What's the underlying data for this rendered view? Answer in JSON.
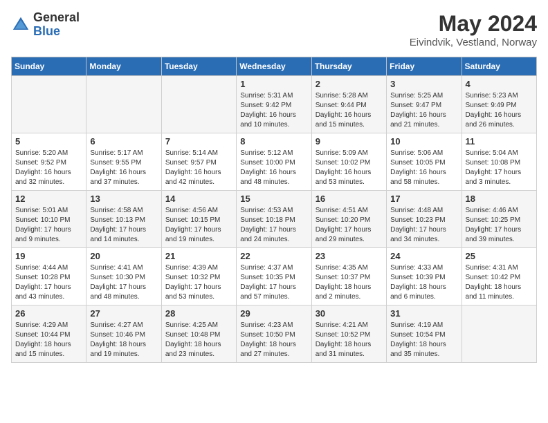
{
  "header": {
    "logo_general": "General",
    "logo_blue": "Blue",
    "month_title": "May 2024",
    "location": "Eivindvik, Vestland, Norway"
  },
  "days_of_week": [
    "Sunday",
    "Monday",
    "Tuesday",
    "Wednesday",
    "Thursday",
    "Friday",
    "Saturday"
  ],
  "weeks": [
    [
      {
        "day": "",
        "info": ""
      },
      {
        "day": "",
        "info": ""
      },
      {
        "day": "",
        "info": ""
      },
      {
        "day": "1",
        "info": "Sunrise: 5:31 AM\nSunset: 9:42 PM\nDaylight: 16 hours and 10 minutes."
      },
      {
        "day": "2",
        "info": "Sunrise: 5:28 AM\nSunset: 9:44 PM\nDaylight: 16 hours and 15 minutes."
      },
      {
        "day": "3",
        "info": "Sunrise: 5:25 AM\nSunset: 9:47 PM\nDaylight: 16 hours and 21 minutes."
      },
      {
        "day": "4",
        "info": "Sunrise: 5:23 AM\nSunset: 9:49 PM\nDaylight: 16 hours and 26 minutes."
      }
    ],
    [
      {
        "day": "5",
        "info": "Sunrise: 5:20 AM\nSunset: 9:52 PM\nDaylight: 16 hours and 32 minutes."
      },
      {
        "day": "6",
        "info": "Sunrise: 5:17 AM\nSunset: 9:55 PM\nDaylight: 16 hours and 37 minutes."
      },
      {
        "day": "7",
        "info": "Sunrise: 5:14 AM\nSunset: 9:57 PM\nDaylight: 16 hours and 42 minutes."
      },
      {
        "day": "8",
        "info": "Sunrise: 5:12 AM\nSunset: 10:00 PM\nDaylight: 16 hours and 48 minutes."
      },
      {
        "day": "9",
        "info": "Sunrise: 5:09 AM\nSunset: 10:02 PM\nDaylight: 16 hours and 53 minutes."
      },
      {
        "day": "10",
        "info": "Sunrise: 5:06 AM\nSunset: 10:05 PM\nDaylight: 16 hours and 58 minutes."
      },
      {
        "day": "11",
        "info": "Sunrise: 5:04 AM\nSunset: 10:08 PM\nDaylight: 17 hours and 3 minutes."
      }
    ],
    [
      {
        "day": "12",
        "info": "Sunrise: 5:01 AM\nSunset: 10:10 PM\nDaylight: 17 hours and 9 minutes."
      },
      {
        "day": "13",
        "info": "Sunrise: 4:58 AM\nSunset: 10:13 PM\nDaylight: 17 hours and 14 minutes."
      },
      {
        "day": "14",
        "info": "Sunrise: 4:56 AM\nSunset: 10:15 PM\nDaylight: 17 hours and 19 minutes."
      },
      {
        "day": "15",
        "info": "Sunrise: 4:53 AM\nSunset: 10:18 PM\nDaylight: 17 hours and 24 minutes."
      },
      {
        "day": "16",
        "info": "Sunrise: 4:51 AM\nSunset: 10:20 PM\nDaylight: 17 hours and 29 minutes."
      },
      {
        "day": "17",
        "info": "Sunrise: 4:48 AM\nSunset: 10:23 PM\nDaylight: 17 hours and 34 minutes."
      },
      {
        "day": "18",
        "info": "Sunrise: 4:46 AM\nSunset: 10:25 PM\nDaylight: 17 hours and 39 minutes."
      }
    ],
    [
      {
        "day": "19",
        "info": "Sunrise: 4:44 AM\nSunset: 10:28 PM\nDaylight: 17 hours and 43 minutes."
      },
      {
        "day": "20",
        "info": "Sunrise: 4:41 AM\nSunset: 10:30 PM\nDaylight: 17 hours and 48 minutes."
      },
      {
        "day": "21",
        "info": "Sunrise: 4:39 AM\nSunset: 10:32 PM\nDaylight: 17 hours and 53 minutes."
      },
      {
        "day": "22",
        "info": "Sunrise: 4:37 AM\nSunset: 10:35 PM\nDaylight: 17 hours and 57 minutes."
      },
      {
        "day": "23",
        "info": "Sunrise: 4:35 AM\nSunset: 10:37 PM\nDaylight: 18 hours and 2 minutes."
      },
      {
        "day": "24",
        "info": "Sunrise: 4:33 AM\nSunset: 10:39 PM\nDaylight: 18 hours and 6 minutes."
      },
      {
        "day": "25",
        "info": "Sunrise: 4:31 AM\nSunset: 10:42 PM\nDaylight: 18 hours and 11 minutes."
      }
    ],
    [
      {
        "day": "26",
        "info": "Sunrise: 4:29 AM\nSunset: 10:44 PM\nDaylight: 18 hours and 15 minutes."
      },
      {
        "day": "27",
        "info": "Sunrise: 4:27 AM\nSunset: 10:46 PM\nDaylight: 18 hours and 19 minutes."
      },
      {
        "day": "28",
        "info": "Sunrise: 4:25 AM\nSunset: 10:48 PM\nDaylight: 18 hours and 23 minutes."
      },
      {
        "day": "29",
        "info": "Sunrise: 4:23 AM\nSunset: 10:50 PM\nDaylight: 18 hours and 27 minutes."
      },
      {
        "day": "30",
        "info": "Sunrise: 4:21 AM\nSunset: 10:52 PM\nDaylight: 18 hours and 31 minutes."
      },
      {
        "day": "31",
        "info": "Sunrise: 4:19 AM\nSunset: 10:54 PM\nDaylight: 18 hours and 35 minutes."
      },
      {
        "day": "",
        "info": ""
      }
    ]
  ]
}
